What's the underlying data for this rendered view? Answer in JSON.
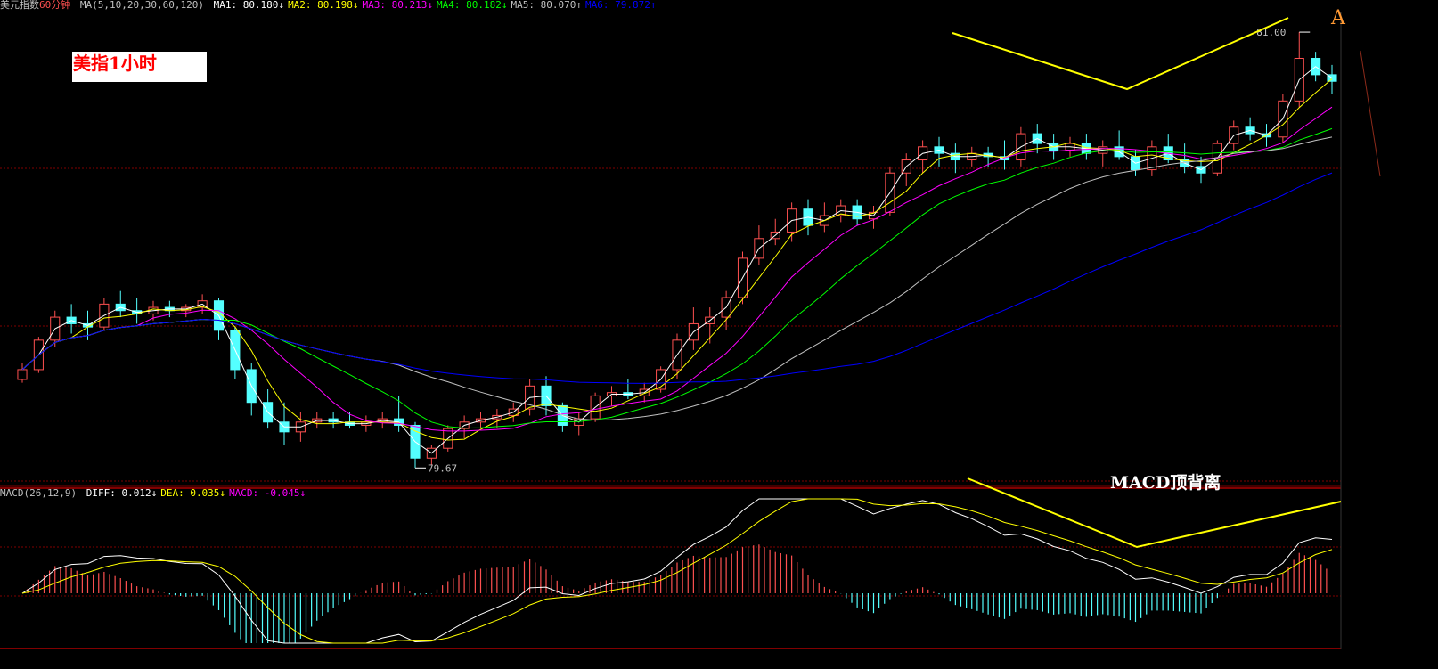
{
  "header": {
    "name": "美元指数",
    "period": "60分钟",
    "ma_params": "MA(5,10,20,30,60,120)",
    "ma": [
      {
        "label": "MA1:",
        "value": "80.180",
        "arrow": "↓",
        "color": "#ffffff"
      },
      {
        "label": "MA2:",
        "value": "80.198",
        "arrow": "↓",
        "color": "#ffff00"
      },
      {
        "label": "MA3:",
        "value": "80.213",
        "arrow": "↓",
        "color": "#ff00ff"
      },
      {
        "label": "MA4:",
        "value": "80.182",
        "arrow": "↓",
        "color": "#00ff00"
      },
      {
        "label": "MA5:",
        "value": "80.070",
        "arrow": "↑",
        "color": "#c0c0c0"
      },
      {
        "label": "MA6:",
        "value": "79.872",
        "arrow": "↑",
        "color": "#0000ff"
      }
    ]
  },
  "macd_header": {
    "params": "MACD(26,12,9)",
    "items": [
      {
        "label": "DIFF:",
        "value": "0.012",
        "arrow": "↓",
        "color": "#ffffff"
      },
      {
        "label": "DEA:",
        "value": "0.035",
        "arrow": "↓",
        "color": "#ffff00"
      },
      {
        "label": "MACD:",
        "value": "-0.045",
        "arrow": "↓",
        "color": "#ff00ff"
      }
    ]
  },
  "annotations": {
    "title": "美指1小时",
    "corner_label": "A",
    "macd_note": "MACD顶背离",
    "high_label": "81.00",
    "low_label": "79.67"
  },
  "colors": {
    "up": "#ff5050",
    "down": "#54ffff",
    "ma1": "#ffffff",
    "ma2": "#ffff00",
    "ma3": "#ff00ff",
    "ma4": "#00ff00",
    "ma5": "#c0c0c0",
    "ma6": "#0000ff",
    "divergence": "#ffff00",
    "grid": "#800000"
  },
  "chart_data": {
    "type": "candlestick",
    "price_range": [
      79.62,
      81.05
    ],
    "candles": [
      {
        "o": 79.93,
        "h": 79.98,
        "l": 79.92,
        "c": 79.96
      },
      {
        "o": 79.96,
        "h": 80.06,
        "l": 79.95,
        "c": 80.05
      },
      {
        "o": 80.05,
        "h": 80.14,
        "l": 80.03,
        "c": 80.12
      },
      {
        "o": 80.12,
        "h": 80.16,
        "l": 80.07,
        "c": 80.1
      },
      {
        "o": 80.1,
        "h": 80.14,
        "l": 80.05,
        "c": 80.09
      },
      {
        "o": 80.09,
        "h": 80.18,
        "l": 80.08,
        "c": 80.16
      },
      {
        "o": 80.16,
        "h": 80.2,
        "l": 80.12,
        "c": 80.14
      },
      {
        "o": 80.14,
        "h": 80.18,
        "l": 80.1,
        "c": 80.13
      },
      {
        "o": 80.13,
        "h": 80.17,
        "l": 80.11,
        "c": 80.15
      },
      {
        "o": 80.15,
        "h": 80.17,
        "l": 80.12,
        "c": 80.14
      },
      {
        "o": 80.14,
        "h": 80.16,
        "l": 80.12,
        "c": 80.15
      },
      {
        "o": 80.15,
        "h": 80.19,
        "l": 80.13,
        "c": 80.17
      },
      {
        "o": 80.17,
        "h": 80.18,
        "l": 80.05,
        "c": 80.08
      },
      {
        "o": 80.08,
        "h": 80.09,
        "l": 79.93,
        "c": 79.96
      },
      {
        "o": 79.96,
        "h": 79.98,
        "l": 79.82,
        "c": 79.86
      },
      {
        "o": 79.86,
        "h": 79.9,
        "l": 79.78,
        "c": 79.8
      },
      {
        "o": 79.8,
        "h": 79.86,
        "l": 79.73,
        "c": 79.77
      },
      {
        "o": 79.77,
        "h": 79.83,
        "l": 79.74,
        "c": 79.8
      },
      {
        "o": 79.8,
        "h": 79.83,
        "l": 79.78,
        "c": 79.81
      },
      {
        "o": 79.81,
        "h": 79.83,
        "l": 79.78,
        "c": 79.8
      },
      {
        "o": 79.8,
        "h": 79.83,
        "l": 79.78,
        "c": 79.79
      },
      {
        "o": 79.79,
        "h": 79.82,
        "l": 79.77,
        "c": 79.8
      },
      {
        "o": 79.8,
        "h": 79.83,
        "l": 79.78,
        "c": 79.81
      },
      {
        "o": 79.81,
        "h": 79.88,
        "l": 79.77,
        "c": 79.79
      },
      {
        "o": 79.79,
        "h": 79.8,
        "l": 79.66,
        "c": 79.69
      },
      {
        "o": 79.69,
        "h": 79.73,
        "l": 79.67,
        "c": 79.72
      },
      {
        "o": 79.72,
        "h": 79.79,
        "l": 79.71,
        "c": 79.78
      },
      {
        "o": 79.78,
        "h": 79.82,
        "l": 79.75,
        "c": 79.8
      },
      {
        "o": 79.8,
        "h": 79.83,
        "l": 79.78,
        "c": 79.81
      },
      {
        "o": 79.81,
        "h": 79.84,
        "l": 79.78,
        "c": 79.82
      },
      {
        "o": 79.82,
        "h": 79.86,
        "l": 79.8,
        "c": 79.84
      },
      {
        "o": 79.84,
        "h": 79.93,
        "l": 79.82,
        "c": 79.91
      },
      {
        "o": 79.91,
        "h": 79.94,
        "l": 79.82,
        "c": 79.85
      },
      {
        "o": 79.85,
        "h": 79.86,
        "l": 79.77,
        "c": 79.79
      },
      {
        "o": 79.79,
        "h": 79.83,
        "l": 79.76,
        "c": 79.81
      },
      {
        "o": 79.81,
        "h": 79.89,
        "l": 79.8,
        "c": 79.88
      },
      {
        "o": 79.88,
        "h": 79.91,
        "l": 79.85,
        "c": 79.89
      },
      {
        "o": 79.89,
        "h": 79.93,
        "l": 79.87,
        "c": 79.88
      },
      {
        "o": 79.88,
        "h": 79.92,
        "l": 79.86,
        "c": 79.9
      },
      {
        "o": 79.9,
        "h": 79.97,
        "l": 79.89,
        "c": 79.96
      },
      {
        "o": 79.96,
        "h": 80.07,
        "l": 79.93,
        "c": 80.05
      },
      {
        "o": 80.05,
        "h": 80.15,
        "l": 80.02,
        "c": 80.1
      },
      {
        "o": 80.1,
        "h": 80.15,
        "l": 80.04,
        "c": 80.12
      },
      {
        "o": 80.12,
        "h": 80.2,
        "l": 80.08,
        "c": 80.18
      },
      {
        "o": 80.18,
        "h": 80.32,
        "l": 80.16,
        "c": 80.3
      },
      {
        "o": 80.3,
        "h": 80.4,
        "l": 80.28,
        "c": 80.36
      },
      {
        "o": 80.36,
        "h": 80.42,
        "l": 80.34,
        "c": 80.38
      },
      {
        "o": 80.38,
        "h": 80.47,
        "l": 80.35,
        "c": 80.45
      },
      {
        "o": 80.45,
        "h": 80.48,
        "l": 80.37,
        "c": 80.4
      },
      {
        "o": 80.4,
        "h": 80.47,
        "l": 80.38,
        "c": 80.43
      },
      {
        "o": 80.43,
        "h": 80.48,
        "l": 80.41,
        "c": 80.46
      },
      {
        "o": 80.46,
        "h": 80.48,
        "l": 80.4,
        "c": 80.42
      },
      {
        "o": 80.42,
        "h": 80.46,
        "l": 80.39,
        "c": 80.44
      },
      {
        "o": 80.44,
        "h": 80.58,
        "l": 80.43,
        "c": 80.56
      },
      {
        "o": 80.56,
        "h": 80.62,
        "l": 80.52,
        "c": 80.6
      },
      {
        "o": 80.6,
        "h": 80.66,
        "l": 80.56,
        "c": 80.64
      },
      {
        "o": 80.64,
        "h": 80.67,
        "l": 80.58,
        "c": 80.62
      },
      {
        "o": 80.62,
        "h": 80.65,
        "l": 80.56,
        "c": 80.6
      },
      {
        "o": 80.6,
        "h": 80.64,
        "l": 80.58,
        "c": 80.62
      },
      {
        "o": 80.62,
        "h": 80.64,
        "l": 80.58,
        "c": 80.61
      },
      {
        "o": 80.61,
        "h": 80.66,
        "l": 80.57,
        "c": 80.6
      },
      {
        "o": 80.6,
        "h": 80.7,
        "l": 80.58,
        "c": 80.68
      },
      {
        "o": 80.68,
        "h": 80.71,
        "l": 80.62,
        "c": 80.65
      },
      {
        "o": 80.65,
        "h": 80.68,
        "l": 80.6,
        "c": 80.63
      },
      {
        "o": 80.63,
        "h": 80.67,
        "l": 80.61,
        "c": 80.65
      },
      {
        "o": 80.65,
        "h": 80.68,
        "l": 80.6,
        "c": 80.62
      },
      {
        "o": 80.62,
        "h": 80.66,
        "l": 80.58,
        "c": 80.64
      },
      {
        "o": 80.64,
        "h": 80.69,
        "l": 80.6,
        "c": 80.61
      },
      {
        "o": 80.61,
        "h": 80.63,
        "l": 80.55,
        "c": 80.57
      },
      {
        "o": 80.57,
        "h": 80.66,
        "l": 80.55,
        "c": 80.64
      },
      {
        "o": 80.64,
        "h": 80.68,
        "l": 80.59,
        "c": 80.6
      },
      {
        "o": 80.6,
        "h": 80.65,
        "l": 80.56,
        "c": 80.58
      },
      {
        "o": 80.58,
        "h": 80.61,
        "l": 80.53,
        "c": 80.56
      },
      {
        "o": 80.56,
        "h": 80.66,
        "l": 80.55,
        "c": 80.65
      },
      {
        "o": 80.65,
        "h": 80.72,
        "l": 80.63,
        "c": 80.7
      },
      {
        "o": 80.7,
        "h": 80.73,
        "l": 80.66,
        "c": 80.68
      },
      {
        "o": 80.68,
        "h": 80.71,
        "l": 80.64,
        "c": 80.67
      },
      {
        "o": 80.67,
        "h": 80.8,
        "l": 80.65,
        "c": 80.78
      },
      {
        "o": 80.78,
        "h": 80.99,
        "l": 80.76,
        "c": 80.91
      },
      {
        "o": 80.91,
        "h": 80.93,
        "l": 80.84,
        "c": 80.86
      },
      {
        "o": 80.86,
        "h": 80.89,
        "l": 80.8,
        "c": 80.84
      }
    ],
    "ma_lines": [
      "MA1",
      "MA2",
      "MA3",
      "MA4",
      "MA5",
      "MA6"
    ],
    "macd": {
      "diff_range": [
        -0.12,
        0.12
      ],
      "comment": "DIFF line (white), DEA line (yellow), histogram bars positive red / negative cyan"
    }
  }
}
